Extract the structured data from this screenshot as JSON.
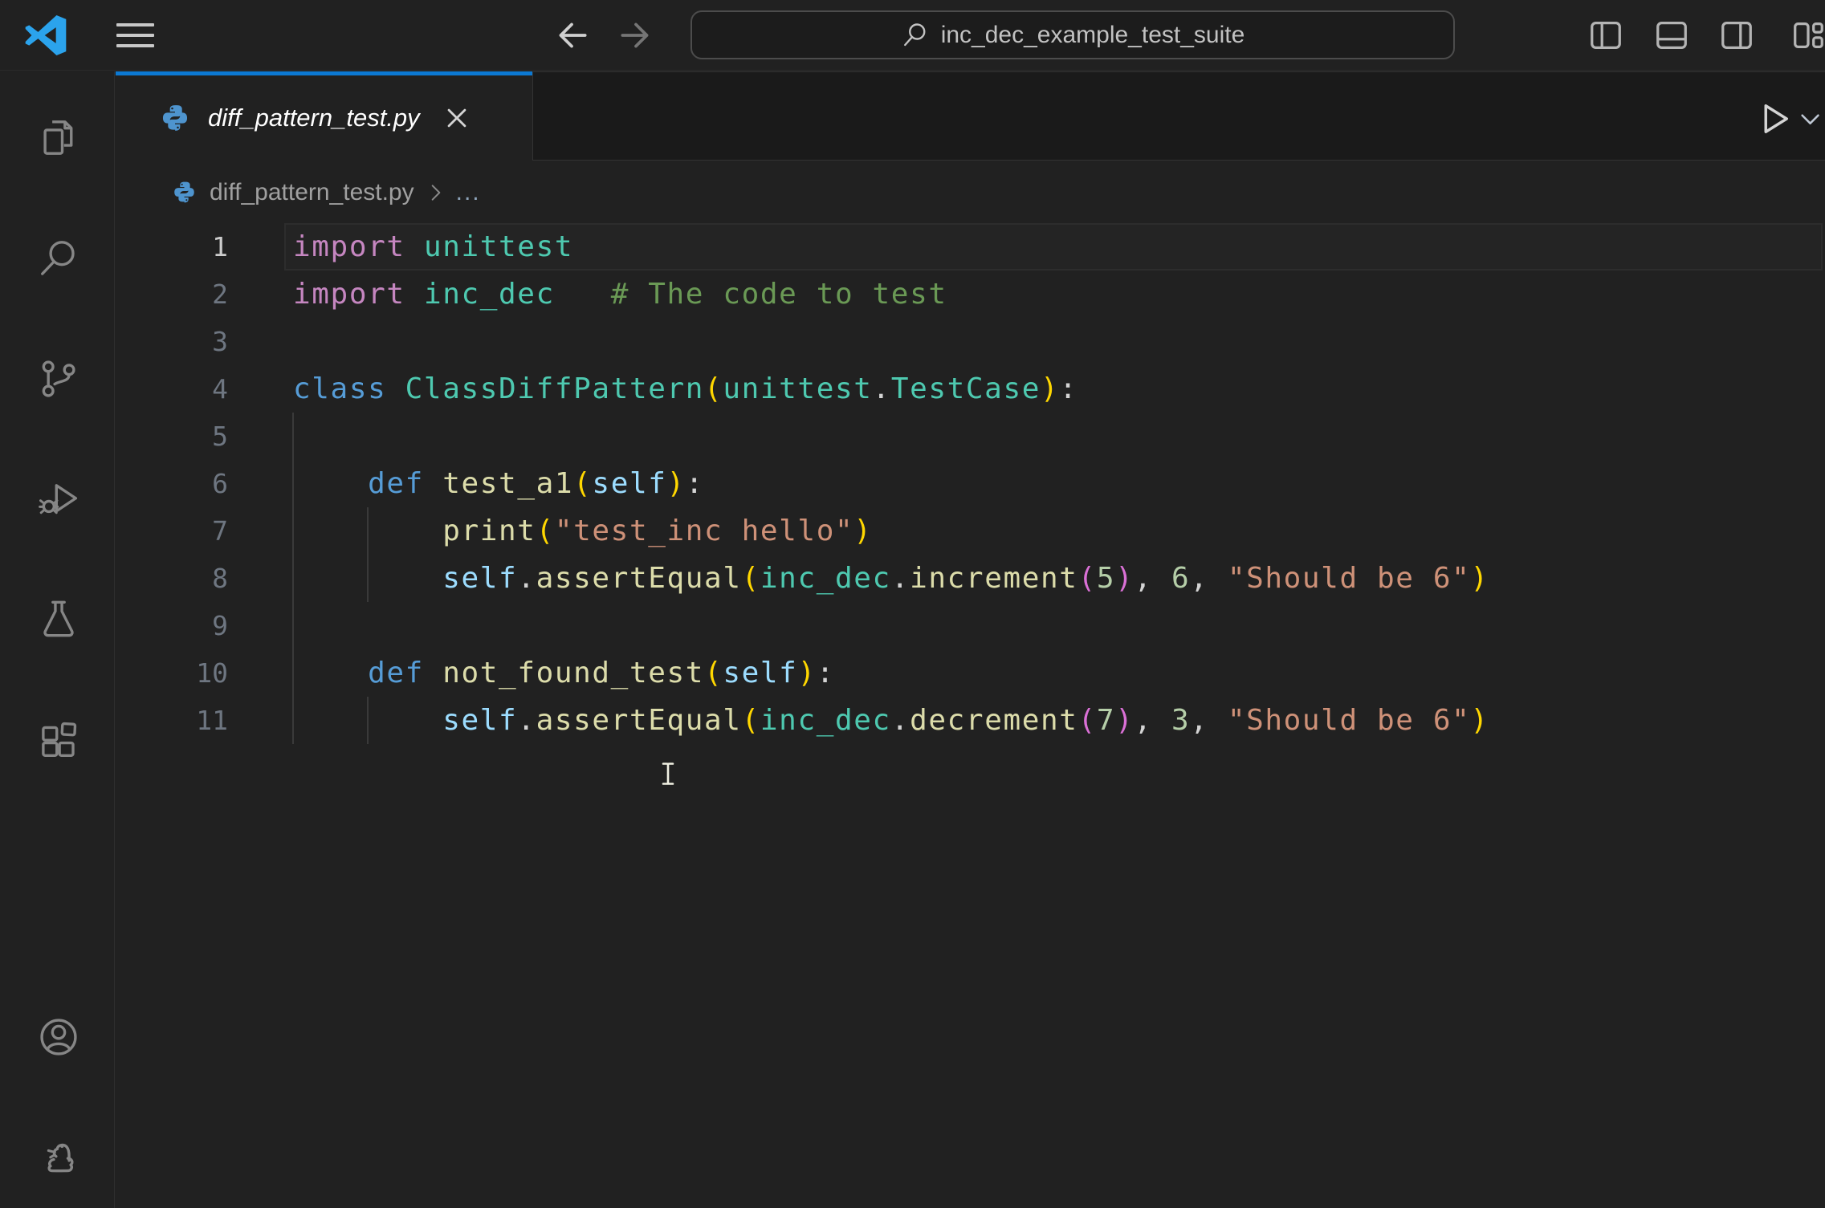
{
  "titlebar": {
    "search_value": "inc_dec_example_test_suite"
  },
  "activity_bar": {
    "items": [
      "explorer",
      "search",
      "source-control",
      "run-and-debug",
      "testing",
      "extensions"
    ],
    "bottom_items": [
      "accounts",
      "python-environment"
    ]
  },
  "editor": {
    "tab": {
      "filename": "diff_pattern_test.py",
      "close_label": "×"
    },
    "breadcrumb": {
      "file": "diff_pattern_test.py",
      "more": "..."
    },
    "active_line": 1,
    "indent_guides": [
      {
        "col": 0,
        "from_line": 5,
        "to_line": 11
      },
      {
        "col": 4,
        "from_line": 7,
        "to_line": 8
      },
      {
        "col": 4,
        "from_line": 11,
        "to_line": 11
      }
    ],
    "lines": [
      {
        "n": 1,
        "tokens": [
          [
            "kw2",
            "import"
          ],
          [
            "p",
            " "
          ],
          [
            "type",
            "unittest"
          ]
        ]
      },
      {
        "n": 2,
        "tokens": [
          [
            "kw2",
            "import"
          ],
          [
            "p",
            " "
          ],
          [
            "type",
            "inc_dec"
          ],
          [
            "p",
            "   "
          ],
          [
            "cm",
            "# The code to test"
          ]
        ]
      },
      {
        "n": 3,
        "tokens": []
      },
      {
        "n": 4,
        "tokens": [
          [
            "kw",
            "class"
          ],
          [
            "p",
            " "
          ],
          [
            "type",
            "ClassDiffPattern"
          ],
          [
            "b1",
            "("
          ],
          [
            "type",
            "unittest"
          ],
          [
            "p",
            "."
          ],
          [
            "type",
            "TestCase"
          ],
          [
            "b1",
            ")"
          ],
          [
            "p",
            ":"
          ]
        ]
      },
      {
        "n": 5,
        "tokens": []
      },
      {
        "n": 6,
        "tokens": [
          [
            "p",
            "    "
          ],
          [
            "kw",
            "def"
          ],
          [
            "p",
            " "
          ],
          [
            "fn",
            "test_a1"
          ],
          [
            "b1",
            "("
          ],
          [
            "self",
            "self"
          ],
          [
            "b1",
            ")"
          ],
          [
            "p",
            ":"
          ]
        ]
      },
      {
        "n": 7,
        "tokens": [
          [
            "p",
            "        "
          ],
          [
            "fn",
            "print"
          ],
          [
            "b1",
            "("
          ],
          [
            "str",
            "\"test_inc hello\""
          ],
          [
            "b1",
            ")"
          ]
        ]
      },
      {
        "n": 8,
        "tokens": [
          [
            "p",
            "        "
          ],
          [
            "self",
            "self"
          ],
          [
            "p",
            "."
          ],
          [
            "fn",
            "assertEqual"
          ],
          [
            "b1",
            "("
          ],
          [
            "type",
            "inc_dec"
          ],
          [
            "p",
            "."
          ],
          [
            "fn",
            "increment"
          ],
          [
            "b2",
            "("
          ],
          [
            "num",
            "5"
          ],
          [
            "b2",
            ")"
          ],
          [
            "p",
            ", "
          ],
          [
            "num",
            "6"
          ],
          [
            "p",
            ", "
          ],
          [
            "str",
            "\"Should be 6\""
          ],
          [
            "b1",
            ")"
          ]
        ]
      },
      {
        "n": 9,
        "tokens": []
      },
      {
        "n": 10,
        "tokens": [
          [
            "p",
            "    "
          ],
          [
            "kw",
            "def"
          ],
          [
            "p",
            " "
          ],
          [
            "fn",
            "not_found_test"
          ],
          [
            "b1",
            "("
          ],
          [
            "self",
            "self"
          ],
          [
            "b1",
            ")"
          ],
          [
            "p",
            ":"
          ]
        ]
      },
      {
        "n": 11,
        "tokens": [
          [
            "p",
            "        "
          ],
          [
            "self",
            "self"
          ],
          [
            "p",
            "."
          ],
          [
            "fn",
            "assertEqual"
          ],
          [
            "b1",
            "("
          ],
          [
            "type",
            "inc_dec"
          ],
          [
            "p",
            "."
          ],
          [
            "fn",
            "decrement"
          ],
          [
            "b2",
            "("
          ],
          [
            "num",
            "7"
          ],
          [
            "b2",
            ")"
          ],
          [
            "p",
            ", "
          ],
          [
            "num",
            "3"
          ],
          [
            "p",
            ", "
          ],
          [
            "str",
            "\"Should be 6\""
          ],
          [
            "b1",
            ")"
          ]
        ]
      }
    ]
  },
  "colors": {
    "accent_blue": "#0c79d3",
    "python_icon_blue": "#4e94ce",
    "chrome_background": "#212121",
    "comment_green": "#6A9955",
    "keyword_blue": "#569CD6",
    "keyword_pink": "#C586C0",
    "type_teal": "#4EC9B0",
    "function_yellow": "#DCDCAA",
    "string_orange": "#CE9178",
    "number_green": "#B5CEA8",
    "bracket_gold": "#FFD700",
    "bracket_pink": "#DA70D6"
  }
}
